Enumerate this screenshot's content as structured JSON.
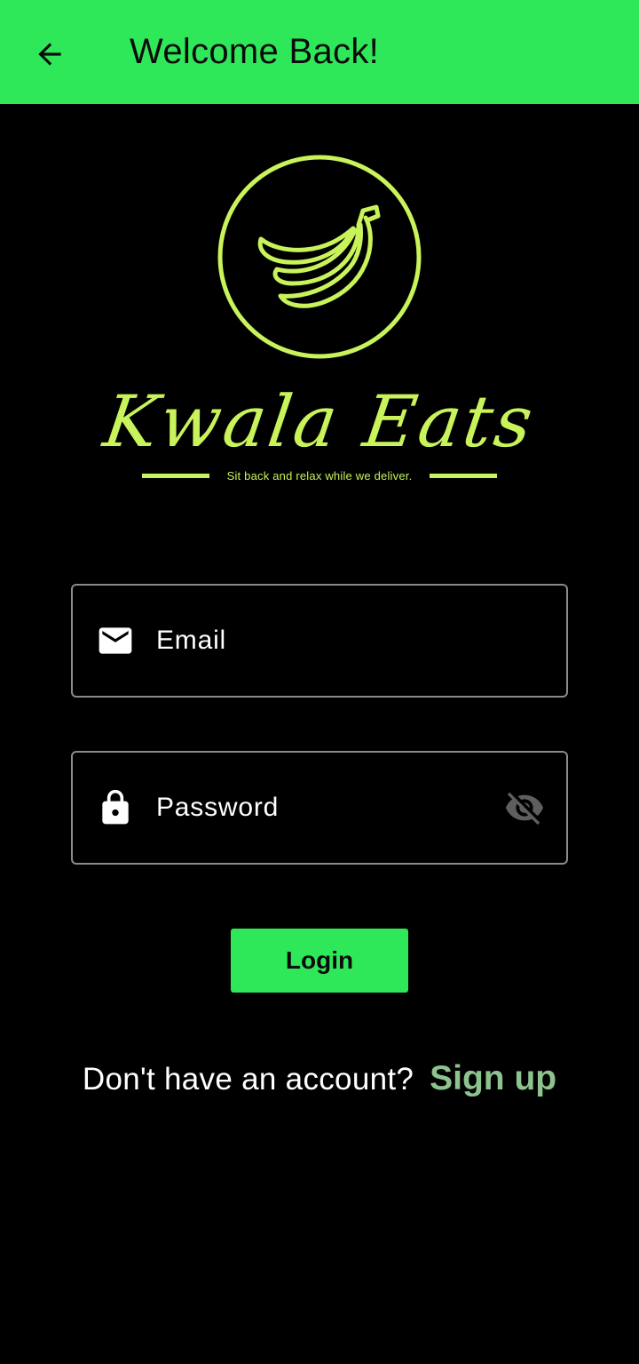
{
  "header": {
    "title": "Welcome Back!",
    "back_icon": "arrow-left-icon",
    "background_color": "#2fe85a"
  },
  "brand": {
    "logo_icon": "banana-icon",
    "name": "Kwala Eats",
    "tagline": "Sit back and relax while we deliver.",
    "accent_color": "#c8f35a"
  },
  "form": {
    "email": {
      "placeholder": "Email",
      "value": "",
      "icon": "mail-icon"
    },
    "password": {
      "placeholder": "Password",
      "value": "",
      "icon": "lock-icon",
      "toggle_icon": "eye-off-icon"
    },
    "login_label": "Login"
  },
  "footer": {
    "prompt": "Don't have an account?",
    "signup_label": "Sign up",
    "signup_color": "#8dc38e"
  }
}
